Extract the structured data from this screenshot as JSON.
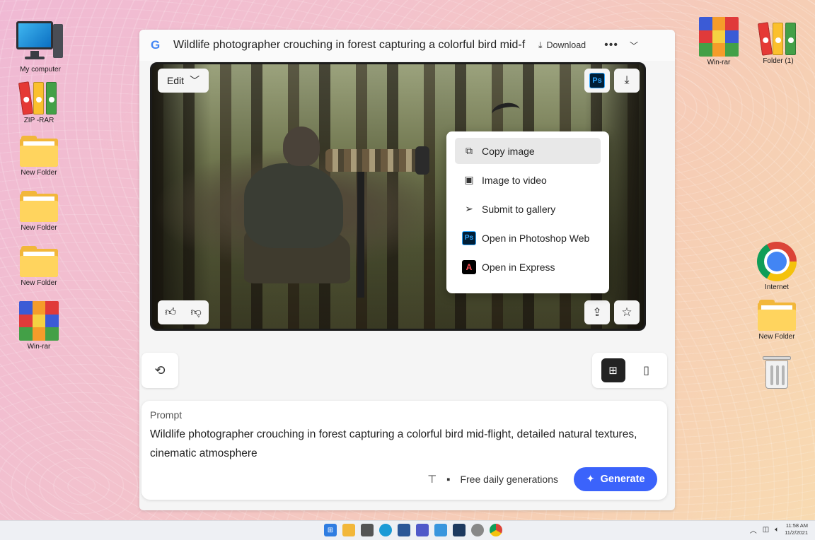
{
  "desktop": {
    "left_icons": [
      {
        "label": "My computer"
      },
      {
        "label": "ZIP -RAR"
      },
      {
        "label": "New Folder"
      },
      {
        "label": "New Folder"
      },
      {
        "label": "New Folder"
      },
      {
        "label": "Win-rar"
      }
    ],
    "right_icons": [
      {
        "label": "Win-rar"
      },
      {
        "label": "Folder (1)"
      },
      {
        "label": "Internet"
      },
      {
        "label": "New Folder"
      },
      {
        "label": "Recycle Bin",
        "icon": "trash-icon"
      }
    ]
  },
  "window": {
    "logo": "G",
    "title": "Wildlife photographer crouching in forest capturing a colorful bird mid-f",
    "download_label": "Download",
    "more_label": "•••",
    "collapse_icon": "chevron-down-icon"
  },
  "image": {
    "edit_label": "Edit",
    "ps_badge": "Ps"
  },
  "context_menu": {
    "items": [
      {
        "label": "Copy image",
        "icon": "copy-icon",
        "active": true
      },
      {
        "label": "Image to video",
        "icon": "video-icon"
      },
      {
        "label": "Submit to gallery",
        "icon": "send-icon"
      },
      {
        "label": "Open in Photoshop Web",
        "icon": "photoshop-icon",
        "badge": "Ps"
      },
      {
        "label": "Open in Express",
        "icon": "express-icon",
        "badge": "A"
      }
    ]
  },
  "prompt": {
    "label": "Prompt",
    "text": "Wildlife photographer crouching in forest capturing a colorful bird mid-flight, detailed natural textures, cinematic atmosphere",
    "free_label": "Free daily generations",
    "generate_label": "Generate"
  },
  "taskbar": {
    "time": "11:58 AM",
    "date": "11/2/2021"
  },
  "colors": {
    "accent": "#3b63fb",
    "ps_dark": "#001e36",
    "ps_blue": "#31a8ff"
  }
}
